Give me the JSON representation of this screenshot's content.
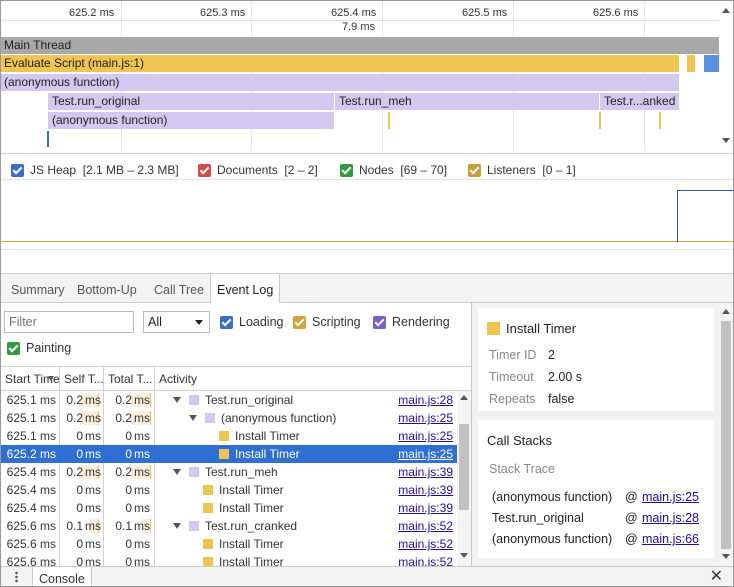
{
  "flame_chart": {
    "ticks": [
      "625.2 ms",
      "625.3 ms",
      "625.4 ms",
      "625.5 ms",
      "625.6 ms"
    ],
    "selection_duration": "7.9 ms",
    "main_thread": "Main Thread",
    "evaluate_script": "Evaluate Script (main.js:1)",
    "anon_function": "(anonymous function)",
    "run_original": "Test.run_original",
    "run_meh": "Test.run_meh",
    "run_cranked": "Test.r...anked",
    "anon_function_inner": "(anonymous function)"
  },
  "counters": [
    {
      "label": "JS Heap",
      "range": "[2.1 MB – 2.3 MB]",
      "color": "#3a6fc6",
      "checked": true
    },
    {
      "label": "Documents",
      "range": "[2 – 2]",
      "color": "#d84a4a",
      "checked": true
    },
    {
      "label": "Nodes",
      "range": "[69 – 70]",
      "color": "#2f9e3f",
      "checked": true
    },
    {
      "label": "Listeners",
      "range": "[0 – 1]",
      "color": "#c99b3a",
      "checked": true
    }
  ],
  "tabs": [
    "Summary",
    "Bottom-Up",
    "Call Tree",
    "Event Log"
  ],
  "active_tab": "Event Log",
  "filter": {
    "placeholder": "Filter",
    "duration_select": "All",
    "categories": [
      {
        "label": "Loading",
        "color": "#3a6fc6",
        "checked": true
      },
      {
        "label": "Scripting",
        "color": "#d6a43a",
        "checked": true
      },
      {
        "label": "Rendering",
        "color": "#7b5fc7",
        "checked": true
      },
      {
        "label": "Painting",
        "color": "#2f9e3f",
        "checked": true
      }
    ]
  },
  "table": {
    "headers": {
      "start_time": "Start Time",
      "self_time": "Self T...",
      "total_time": "Total T...",
      "activity": "Activity"
    },
    "rows": [
      {
        "start": "625.1 ms",
        "self_val": "0.2",
        "self_unit": "ms",
        "total_val": "0.2",
        "total_unit": "ms",
        "activity": "Test.run_original",
        "color": "purple",
        "expander": true,
        "indent": 0,
        "location": "main.js:28",
        "selected": false,
        "self_hl": 0.14,
        "total_hl": 0.14
      },
      {
        "start": "625.1 ms",
        "self_val": "0.2",
        "self_unit": "ms",
        "total_val": "0.2",
        "total_unit": "ms",
        "activity": "(anonymous function)",
        "color": "purple",
        "expander": true,
        "indent": 1,
        "location": "main.js:25",
        "selected": false,
        "self_hl": 0.14,
        "total_hl": 0.14
      },
      {
        "start": "625.1 ms",
        "self_val": "0",
        "self_unit": "ms",
        "total_val": "0",
        "total_unit": "ms",
        "activity": "Install Timer",
        "color": "yellow",
        "expander": false,
        "indent": 2,
        "location": "main.js:25",
        "selected": false,
        "self_hl": 0,
        "total_hl": 0
      },
      {
        "start": "625.2 ms",
        "self_val": "0",
        "self_unit": "ms",
        "total_val": "0",
        "total_unit": "ms",
        "activity": "Install Timer",
        "color": "yellow",
        "expander": false,
        "indent": 2,
        "location": "main.js:25",
        "selected": true,
        "self_hl": 0,
        "total_hl": 0
      },
      {
        "start": "625.4 ms",
        "self_val": "0.2",
        "self_unit": "ms",
        "total_val": "0.2",
        "total_unit": "ms",
        "activity": "Test.run_meh",
        "color": "purple",
        "expander": true,
        "indent": 0,
        "location": "main.js:39",
        "selected": false,
        "self_hl": 0.14,
        "total_hl": 0.14
      },
      {
        "start": "625.4 ms",
        "self_val": "0",
        "self_unit": "ms",
        "total_val": "0",
        "total_unit": "ms",
        "activity": "Install Timer",
        "color": "yellow",
        "expander": false,
        "indent": 1,
        "location": "main.js:39",
        "selected": false,
        "self_hl": 0,
        "total_hl": 0
      },
      {
        "start": "625.4 ms",
        "self_val": "0",
        "self_unit": "ms",
        "total_val": "0",
        "total_unit": "ms",
        "activity": "Install Timer",
        "color": "yellow",
        "expander": false,
        "indent": 1,
        "location": "main.js:39",
        "selected": false,
        "self_hl": 0,
        "total_hl": 0
      },
      {
        "start": "625.6 ms",
        "self_val": "0.1",
        "self_unit": "ms",
        "total_val": "0.1",
        "total_unit": "ms",
        "activity": "Test.run_cranked",
        "color": "purple",
        "expander": true,
        "indent": 0,
        "location": "main.js:52",
        "selected": false,
        "self_hl": 0.07,
        "total_hl": 0.07
      },
      {
        "start": "625.6 ms",
        "self_val": "0",
        "self_unit": "ms",
        "total_val": "0",
        "total_unit": "ms",
        "activity": "Install Timer",
        "color": "yellow",
        "expander": false,
        "indent": 1,
        "location": "main.js:52",
        "selected": false,
        "self_hl": 0,
        "total_hl": 0
      },
      {
        "start": "625.6 ms",
        "self_val": "0",
        "self_unit": "ms",
        "total_val": "0",
        "total_unit": "ms",
        "activity": "Install Timer",
        "color": "yellow",
        "expander": false,
        "indent": 1,
        "location": "main.js:52",
        "selected": false,
        "self_hl": 0,
        "total_hl": 0
      }
    ]
  },
  "details": {
    "title": "Install Timer",
    "title_color": "#f0c453",
    "props": [
      {
        "key": "Timer ID",
        "value": "2"
      },
      {
        "key": "Timeout",
        "value": "2.00 s"
      },
      {
        "key": "Repeats",
        "value": "false"
      }
    ],
    "call_stacks_title": "Call Stacks",
    "stack_trace_label": "Stack Trace",
    "frames": [
      {
        "fn": "(anonymous function)",
        "at": "@",
        "location": "main.js:25"
      },
      {
        "fn": "Test.run_original",
        "at": "@",
        "location": "main.js:28"
      },
      {
        "fn": "(anonymous function)",
        "at": "@",
        "location": "main.js:66"
      }
    ]
  },
  "drawer": {
    "console_tab": "Console",
    "close_symbol": "✕"
  }
}
